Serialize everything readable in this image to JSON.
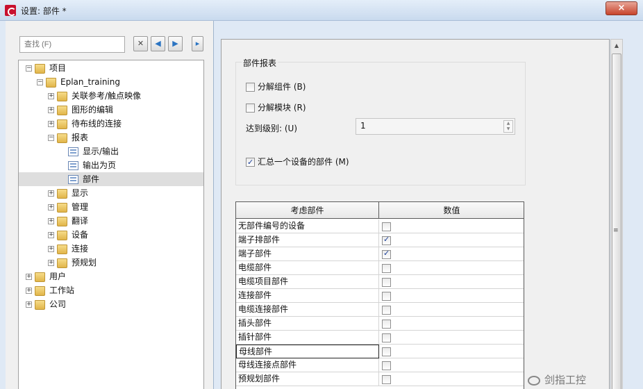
{
  "window": {
    "title": "设置: 部件 *",
    "close_label": "×"
  },
  "left": {
    "search_placeholder": "查找 (F)",
    "tree": [
      {
        "label": "项目",
        "level": 0,
        "expander": "−",
        "icon": "folder"
      },
      {
        "label": "Eplan_training",
        "level": 1,
        "expander": "−",
        "icon": "folder"
      },
      {
        "label": "关联参考/触点映像",
        "level": 2,
        "expander": "+",
        "icon": "folder"
      },
      {
        "label": "图形的编辑",
        "level": 2,
        "expander": "+",
        "icon": "folder"
      },
      {
        "label": "待布线的连接",
        "level": 2,
        "expander": "+",
        "icon": "folder"
      },
      {
        "label": "报表",
        "level": 2,
        "expander": "−",
        "icon": "folder"
      },
      {
        "label": "显示/输出",
        "level": 3,
        "expander": "",
        "icon": "page"
      },
      {
        "label": "输出为页",
        "level": 3,
        "expander": "",
        "icon": "page"
      },
      {
        "label": "部件",
        "level": 3,
        "expander": "",
        "icon": "page",
        "selected": true
      },
      {
        "label": "显示",
        "level": 2,
        "expander": "+",
        "icon": "folder"
      },
      {
        "label": "管理",
        "level": 2,
        "expander": "+",
        "icon": "folder"
      },
      {
        "label": "翻译",
        "level": 2,
        "expander": "+",
        "icon": "folder"
      },
      {
        "label": "设备",
        "level": 2,
        "expander": "+",
        "icon": "folder"
      },
      {
        "label": "连接",
        "level": 2,
        "expander": "+",
        "icon": "folder"
      },
      {
        "label": "预规划",
        "level": 2,
        "expander": "+",
        "icon": "folder"
      },
      {
        "label": "用户",
        "level": 0,
        "expander": "+",
        "icon": "folder"
      },
      {
        "label": "工作站",
        "level": 0,
        "expander": "+",
        "icon": "folder"
      },
      {
        "label": "公司",
        "level": 0,
        "expander": "+",
        "icon": "folder"
      }
    ]
  },
  "report": {
    "group_title": "部件报表",
    "explode_assembly": {
      "label": "分解组件 (B)",
      "checked": false
    },
    "explode_module": {
      "label": "分解模块 (R)",
      "checked": false
    },
    "level_label": "达到级别: (U)",
    "level_value": "1",
    "summarize": {
      "label": "汇总一个设备的部件 (M)",
      "checked": true
    }
  },
  "table": {
    "col_parts": "考虑部件",
    "col_value": "数值",
    "rows": [
      {
        "label": "无部件编号的设备",
        "checked": false
      },
      {
        "label": "端子排部件",
        "checked": true
      },
      {
        "label": "端子部件",
        "checked": true
      },
      {
        "label": "电缆部件",
        "checked": false
      },
      {
        "label": "电缆项目部件",
        "checked": false
      },
      {
        "label": "连接部件",
        "checked": false
      },
      {
        "label": "电缆连接部件",
        "checked": false
      },
      {
        "label": "插头部件",
        "checked": false
      },
      {
        "label": "插针部件",
        "checked": false
      },
      {
        "label": "母线部件",
        "checked": false,
        "focused": true
      },
      {
        "label": "母线连接点部件",
        "checked": false
      },
      {
        "label": "预规划部件",
        "checked": false
      }
    ]
  },
  "watermark": "剑指工控"
}
